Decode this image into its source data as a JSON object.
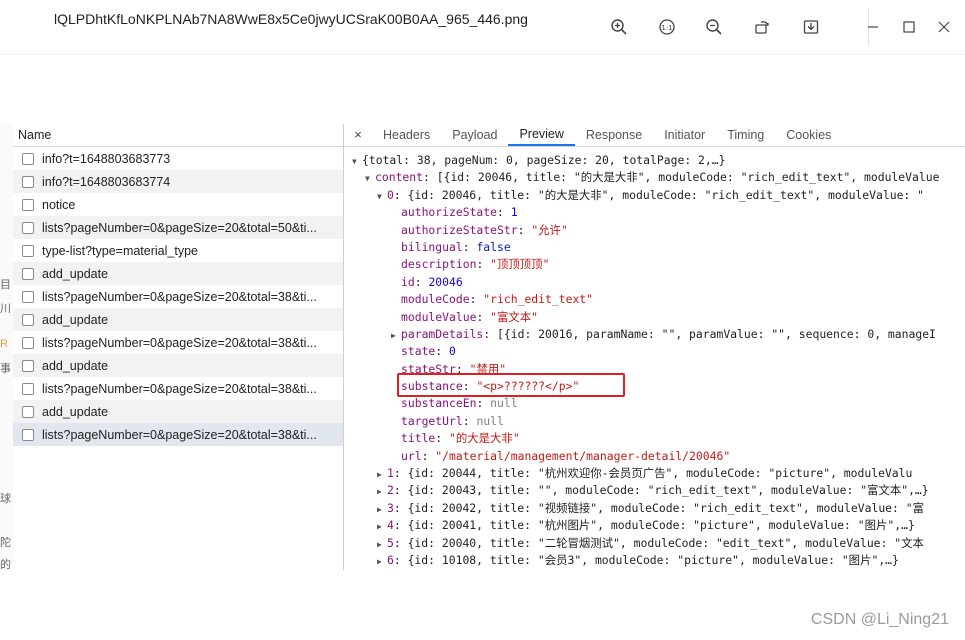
{
  "window": {
    "filename": "lQLPDhtKfLoNKPLNAb7NA8WwE8x5Ce0jwyUCSraK00B0AA_965_446.png"
  },
  "icons": {
    "zoom_in": "zoom-in-icon",
    "actual_size": "actual-size-icon",
    "zoom_out": "zoom-out-icon",
    "rotate": "rotate-icon",
    "download": "download-icon",
    "minimize": "minimize-icon",
    "maximize": "maximize-icon",
    "close": "close-icon"
  },
  "background_fragments": [
    "目",
    "川",
    "R",
    "事",
    "",
    "球",
    "陀",
    "的"
  ],
  "requests": {
    "header": "Name",
    "items": [
      {
        "name": "info?t=1648803683773"
      },
      {
        "name": "info?t=1648803683774"
      },
      {
        "name": "notice"
      },
      {
        "name": "lists?pageNumber=0&pageSize=20&total=50&ti..."
      },
      {
        "name": "type-list?type=material_type"
      },
      {
        "name": "add_update"
      },
      {
        "name": "lists?pageNumber=0&pageSize=20&total=38&ti..."
      },
      {
        "name": "add_update"
      },
      {
        "name": "lists?pageNumber=0&pageSize=20&total=38&ti..."
      },
      {
        "name": "add_update"
      },
      {
        "name": "lists?pageNumber=0&pageSize=20&total=38&ti..."
      },
      {
        "name": "add_update"
      },
      {
        "name": "lists?pageNumber=0&pageSize=20&total=38&ti..."
      }
    ]
  },
  "tabs": {
    "close": "×",
    "items": [
      "Headers",
      "Payload",
      "Preview",
      "Response",
      "Initiator",
      "Timing",
      "Cookies"
    ],
    "active": "Preview"
  },
  "preview": {
    "root": "{total: 38, pageNum: 0, pageSize: 20, totalPage: 2,…}",
    "content_key": "content",
    "content_summary": "[{id: 20046, title: \"的大是大非\", moduleCode: \"rich_edit_text\", moduleValue",
    "item0_key": "0",
    "item0_summary": "{id: 20046, title: \"的大是大非\", moduleCode: \"rich_edit_text\", moduleValue: \"",
    "fields": [
      {
        "key": "authorizeState",
        "value": "1",
        "type": "n"
      },
      {
        "key": "authorizeStateStr",
        "value": "\"允许\"",
        "type": "s"
      },
      {
        "key": "bilingual",
        "value": "false",
        "type": "b"
      },
      {
        "key": "description",
        "value": "\"顶顶顶顶\"",
        "type": "s"
      },
      {
        "key": "id",
        "value": "20046",
        "type": "n"
      },
      {
        "key": "moduleCode",
        "value": "\"rich_edit_text\"",
        "type": "s"
      },
      {
        "key": "moduleValue",
        "value": "\"富文本\"",
        "type": "s"
      },
      {
        "key": "paramDetails",
        "value": "[{id: 20016, paramName: \"\", paramValue: \"\", sequence: 0, manageI",
        "type": "p"
      },
      {
        "key": "state",
        "value": "0",
        "type": "n"
      },
      {
        "key": "stateStr",
        "value": "\"禁用\"",
        "type": "s"
      },
      {
        "key": "substance",
        "value": "\"<p>??????</p>\"",
        "type": "s"
      },
      {
        "key": "substanceEn",
        "value": "null",
        "type": "nl"
      },
      {
        "key": "targetUrl",
        "value": "null",
        "type": "nl"
      },
      {
        "key": "title",
        "value": "\"的大是大非\"",
        "type": "s"
      },
      {
        "key": "url",
        "value": "\"/material/management/manager-detail/20046\"",
        "type": "s"
      }
    ],
    "collapsed_items": [
      {
        "index": "1",
        "summary": "{id: 20044, title: \"杭州欢迎你-会员页广告\", moduleCode: \"picture\", moduleValu"
      },
      {
        "index": "2",
        "summary": "{id: 20043, title: \"\", moduleCode: \"rich_edit_text\", moduleValue: \"富文本\",…}"
      },
      {
        "index": "3",
        "summary": "{id: 20042, title: \"视频链接\", moduleCode: \"rich_edit_text\", moduleValue: \"富"
      },
      {
        "index": "4",
        "summary": "{id: 20041, title: \"杭州图片\", moduleCode: \"picture\", moduleValue: \"图片\",…}"
      },
      {
        "index": "5",
        "summary": "{id: 20040, title: \"二轮冒烟测试\", moduleCode: \"edit_text\", moduleValue: \"文本"
      },
      {
        "index": "6",
        "summary": "{id: 10108, title: \"会员3\", moduleCode: \"picture\", moduleValue: \"图片\",…}"
      }
    ]
  },
  "watermark": "CSDN @Li_Ning21",
  "colors": {
    "key": "#881280",
    "string": "#c41a16",
    "number": "#1c00cf",
    "active_tab": "#1a73e8",
    "highlight": "#e02020"
  }
}
